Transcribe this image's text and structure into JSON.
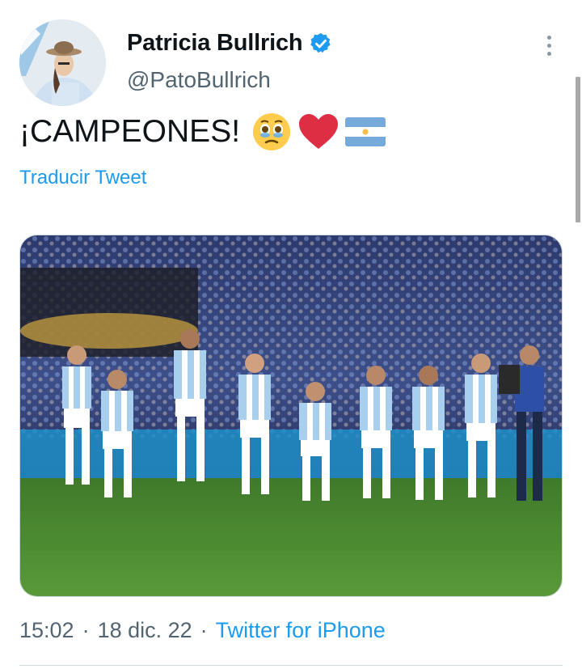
{
  "author": {
    "display_name": "Patricia Bullrich",
    "handle": "@PatoBullrich",
    "verified": true
  },
  "tweet": {
    "text": "¡CAMPEONES!",
    "emojis": [
      "face-holding-back-tears-icon",
      "red-heart-icon",
      "argentina-flag-icon"
    ],
    "translate_label": "Traducir Tweet"
  },
  "media": {
    "description_icon": "photo-argentina-team-celebration"
  },
  "meta": {
    "time": "15:02",
    "date": "18 dic. 22",
    "separator": "·",
    "source": "Twitter for iPhone"
  },
  "colors": {
    "accent": "#1d9bf0",
    "secondary_text": "#536471",
    "heart": "#e0245e",
    "flag_blue": "#75aadb"
  }
}
